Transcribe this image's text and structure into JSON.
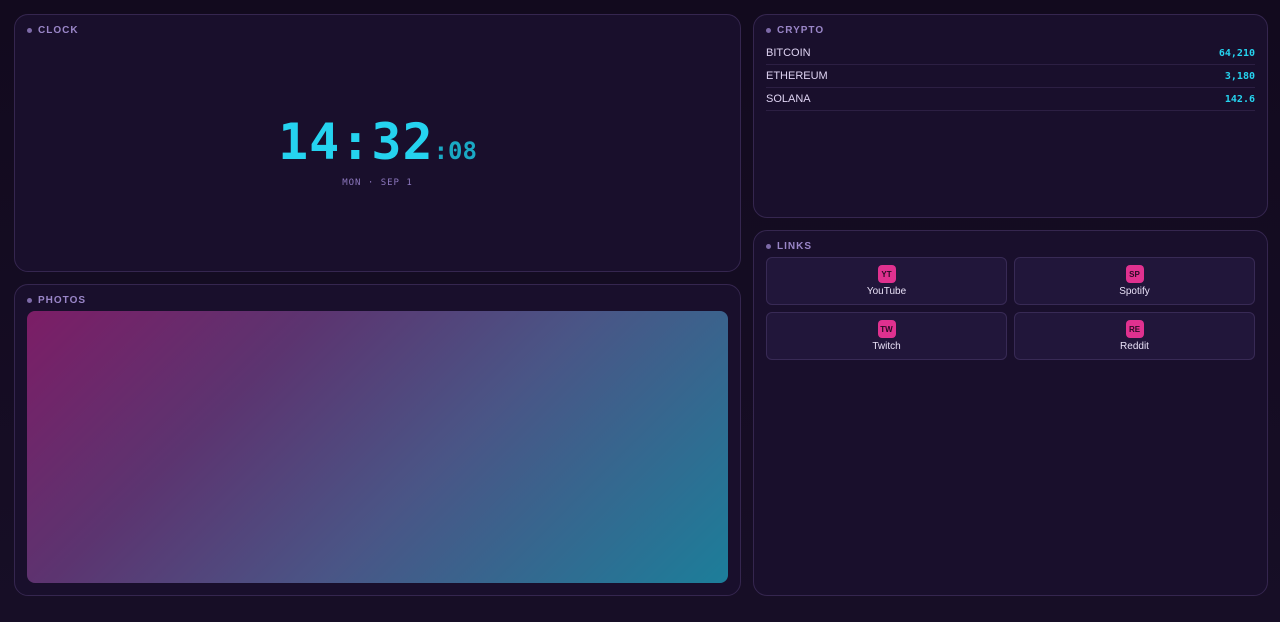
{
  "clock": {
    "title": "CLOCK",
    "time": "14:32",
    "seconds": ":08",
    "date": "MON · SEP 1"
  },
  "photos": {
    "title": "PHOTOS"
  },
  "crypto": {
    "title": "CRYPTO",
    "rows": [
      {
        "name": "BITCOIN",
        "price": "64,210"
      },
      {
        "name": "ETHEREUM",
        "price": "3,180"
      },
      {
        "name": "SOLANA",
        "price": "142.6"
      }
    ]
  },
  "links": {
    "title": "LINKS",
    "items": [
      {
        "badge": "YT",
        "label": "YouTube"
      },
      {
        "badge": "SP",
        "label": "Spotify"
      },
      {
        "badge": "TW",
        "label": "Twitch"
      },
      {
        "badge": "RE",
        "label": "Reddit"
      }
    ]
  },
  "colors": {
    "accent_cyan": "#25d3ef",
    "accent_pink": "#e0318f",
    "panel_bg": "#190f2c",
    "page_bg": "#150c22"
  }
}
